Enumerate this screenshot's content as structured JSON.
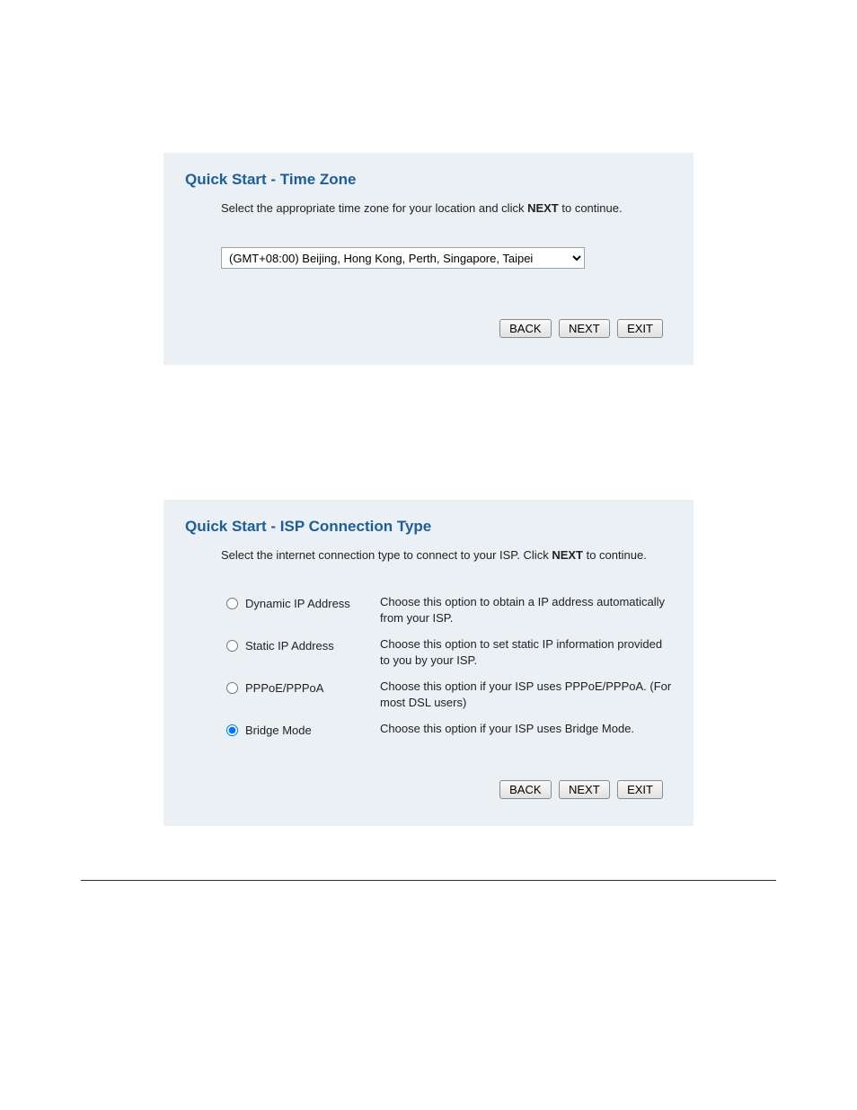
{
  "timezone_panel": {
    "title": "Quick Start - Time Zone",
    "instruction_pre": "Select the appropriate time zone for your location and click ",
    "instruction_bold": "NEXT",
    "instruction_post": " to continue.",
    "selected": "(GMT+08:00) Beijing, Hong Kong, Perth, Singapore, Taipei",
    "buttons": {
      "back": "BACK",
      "next": "NEXT",
      "exit": "EXIT"
    }
  },
  "isp_panel": {
    "title": "Quick Start - ISP Connection Type",
    "instruction_pre": "Select the internet connection type to connect to your ISP. Click ",
    "instruction_bold": "NEXT",
    "instruction_post": " to continue.",
    "options": [
      {
        "label": "Dynamic IP Address",
        "desc": "Choose this option to obtain a IP address automatically from your ISP.",
        "checked": false
      },
      {
        "label": "Static IP Address",
        "desc": "Choose this option to set static IP information provided to you by your ISP.",
        "checked": false
      },
      {
        "label": "PPPoE/PPPoA",
        "desc": "Choose this option if your ISP uses PPPoE/PPPoA. (For most DSL users)",
        "checked": false
      },
      {
        "label": "Bridge Mode",
        "desc": "Choose this option if your ISP uses Bridge Mode.",
        "checked": true
      }
    ],
    "buttons": {
      "back": "BACK",
      "next": "NEXT",
      "exit": "EXIT"
    }
  }
}
